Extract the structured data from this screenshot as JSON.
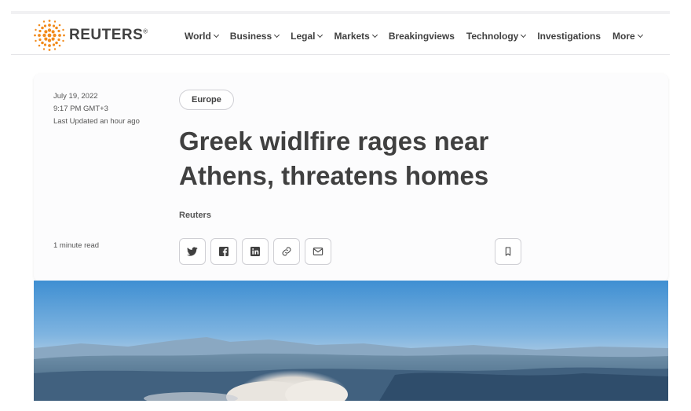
{
  "brand": {
    "name": "REUTERS",
    "mark": "®"
  },
  "nav": {
    "items": [
      {
        "label": "World",
        "dropdown": true
      },
      {
        "label": "Business",
        "dropdown": true
      },
      {
        "label": "Legal",
        "dropdown": true
      },
      {
        "label": "Markets",
        "dropdown": true
      },
      {
        "label": "Breakingviews",
        "dropdown": false
      },
      {
        "label": "Technology",
        "dropdown": true
      },
      {
        "label": "Investigations",
        "dropdown": false
      },
      {
        "label": "More",
        "dropdown": true
      }
    ]
  },
  "article": {
    "date": "July 19, 2022",
    "time": "9:17 PM GMT+3",
    "updated": "Last Updated an hour ago",
    "read_time": "1 minute read",
    "tag": "Europe",
    "headline": "Greek widlfire rages near Athens, threatens homes",
    "byline": "Reuters"
  },
  "share": {
    "buttons": [
      "twitter-icon",
      "facebook-icon",
      "linkedin-icon",
      "link-icon",
      "email-icon"
    ],
    "bookmark": "bookmark-icon"
  },
  "colors": {
    "logo_orange": "#f28b1d",
    "text": "#404040",
    "border": "#cfcfd4",
    "sky": "#3f8fd2"
  }
}
